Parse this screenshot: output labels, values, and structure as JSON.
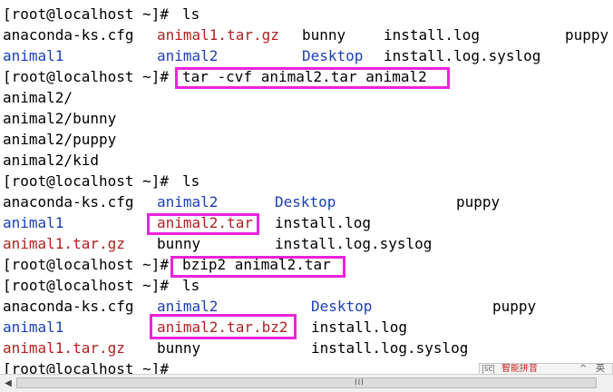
{
  "prompt": "[root@localhost ~]#",
  "commands": {
    "ls": "ls",
    "tar": "tar -cvf animal2.tar animal2",
    "bzip2": "bzip2 animal2.tar"
  },
  "ls1": {
    "row1": [
      "anaconda-ks.cfg",
      "animal1.tar.gz",
      "bunny",
      "install.log",
      "puppy"
    ],
    "row2": [
      "animal1",
      "animal2",
      "Desktop",
      "install.log.syslog"
    ]
  },
  "tar_output": [
    "animal2/",
    "animal2/bunny",
    "animal2/puppy",
    "animal2/kid"
  ],
  "ls2": {
    "row1": [
      "anaconda-ks.cfg",
      "animal2",
      "Desktop",
      "puppy"
    ],
    "row2": [
      "animal1",
      "animal2.tar",
      "install.log"
    ],
    "row3": [
      "animal1.tar.gz",
      "bunny",
      "install.log.syslog"
    ]
  },
  "ls3": {
    "row1": [
      "anaconda-ks.cfg",
      "animal2",
      "Desktop",
      "puppy"
    ],
    "row2": [
      "animal1",
      "animal2.tar.bz2",
      "install.log"
    ],
    "row3": [
      "animal1.tar.gz",
      "bunny",
      "install.log.syslog"
    ]
  },
  "scrollbar": {
    "grip": "III"
  },
  "ime": {
    "label1": "SC",
    "label2": "智能拼音",
    "label3": "^",
    "label4": "英"
  },
  "colors": {
    "directory": "#1b3fb6",
    "archive": "#b1201f",
    "file": "#000000",
    "highlight_box": "#ee22dd"
  }
}
